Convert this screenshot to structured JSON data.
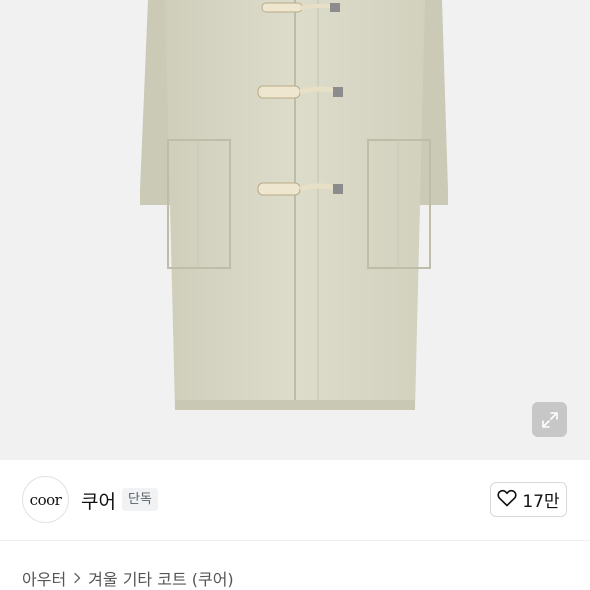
{
  "product": {
    "image_alt": "beige duffle coat",
    "expand_icon": "expand-arrows-icon"
  },
  "brand": {
    "logo_text": "coor",
    "name": "쿠어",
    "badge": "단독"
  },
  "like": {
    "icon": "heart-outline-icon",
    "count": "17만"
  },
  "breadcrumb": {
    "items": [
      "아우터",
      "겨울 기타 코트 (쿠어)"
    ],
    "separator_icon": "chevron-right-icon"
  },
  "colors": {
    "coat": "#d9d8c6",
    "background": "#f1f1f1",
    "toggle": "#efe6cf"
  }
}
